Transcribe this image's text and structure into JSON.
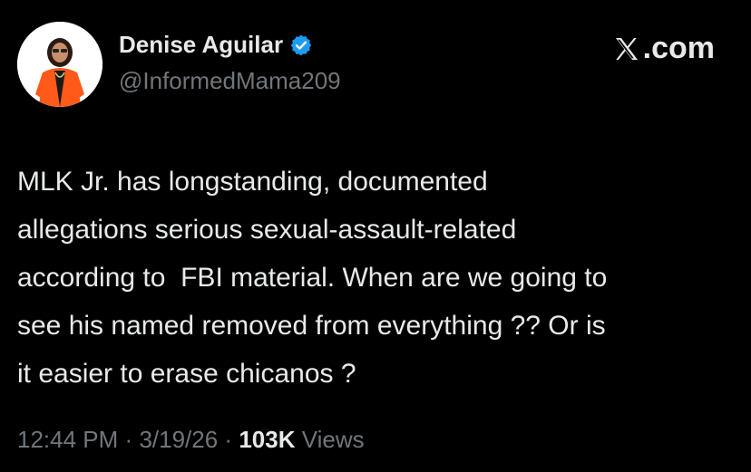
{
  "author": {
    "display_name": "Denise Aguilar",
    "handle": "@InformedMama209",
    "verified": true,
    "verified_color": "#1d9bf0"
  },
  "brand": {
    "logo_icon": "x-logo-icon",
    "suffix": ".com"
  },
  "tweet": {
    "text": "MLK Jr. has longstanding, documented\nallegations serious sexual-assault-related\naccording to  FBI material. When are we going to\nsee his named removed from everything ?? Or is\nit easier to erase chicanos ?"
  },
  "meta": {
    "time": "12:44 PM",
    "separator": "·",
    "date": "3/19/26",
    "views_count": "103K",
    "views_label": "Views"
  },
  "colors": {
    "background": "#000000",
    "primary_text": "#e7e9ea",
    "secondary_text": "#71767b",
    "avatar_jacket": "#ff5a1a"
  }
}
